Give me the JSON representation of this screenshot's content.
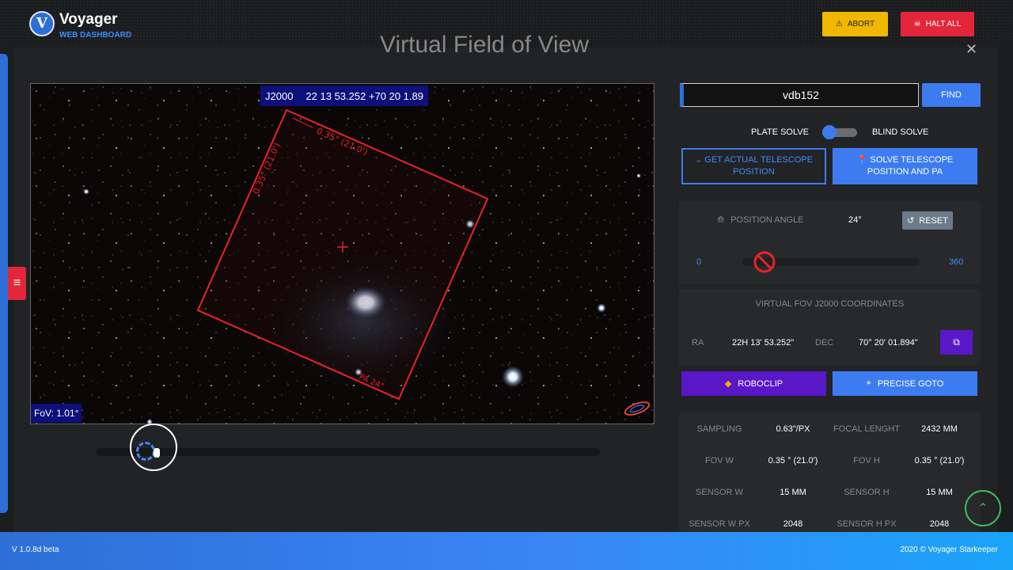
{
  "brand": {
    "title": "Voyager",
    "subtitle": "WEB DASHBOARD",
    "logo_letter": "V"
  },
  "header": {
    "abort": {
      "label": "ABORT",
      "icon": "warning-icon",
      "color": "#f0b800"
    },
    "halt_all": {
      "label": "HALT ALL",
      "icon": "skull-icon",
      "color": "#e3263a"
    }
  },
  "modal": {
    "title": "Virtual Field of View",
    "close_icon": "close-icon"
  },
  "viewer": {
    "coord_epoch": "J2000",
    "coord_text": "22 13 53.252 +70 20 1.89",
    "fov_label": "FoV: 1.01°",
    "frame_width_label": "0.35° (21.0')",
    "frame_height_label": "0.35° (21.0')",
    "pa_label": "PA 24°",
    "frame_color": "#e8222a",
    "zoom_level": 0.1
  },
  "search": {
    "value": "vdb152",
    "find_label": "FIND"
  },
  "solve_mode": {
    "left": "PLATE SOLVE",
    "right": "BLIND SOLVE",
    "blind_enabled": false
  },
  "actions": {
    "get_position": "GET ACTUAL TELESCOPE POSITION",
    "solve_position": "SOLVE TELESCOPE POSITION AND PA"
  },
  "position_angle": {
    "label": "POSITION ANGLE",
    "value": "24°",
    "reset_label": "RESET",
    "min": "0",
    "max": "360",
    "current": 24
  },
  "coordinates": {
    "title": "VIRTUAL FOV J2000 COORDINATES",
    "ra_label": "RA",
    "ra_value": "22H 13' 53.252\"",
    "dec_label": "DEC",
    "dec_value": "70° 20' 01.894\""
  },
  "buttons": {
    "roboclip": "ROBOCLIP",
    "precise_goto": "PRECISE GOTO"
  },
  "stats": [
    {
      "label": "SAMPLING",
      "value": "0.63\"/PX",
      "label2": "FOCAL LENGHT",
      "value2": "2432 MM"
    },
    {
      "label": "FOV W",
      "value": "0.35 ° (21.0')",
      "label2": "FOV H",
      "value2": "0.35 ° (21.0')"
    },
    {
      "label": "SENSOR W",
      "value": "15 MM",
      "label2": "SENSOR H",
      "value2": "15 MM"
    },
    {
      "label": "SENSOR W PX",
      "value": "2048",
      "label2": "SENSOR H PX",
      "value2": "2048"
    }
  ],
  "footer": {
    "version": "V 1.0.8d beta",
    "copyright": "2020 © Voyager Starkeeper"
  }
}
